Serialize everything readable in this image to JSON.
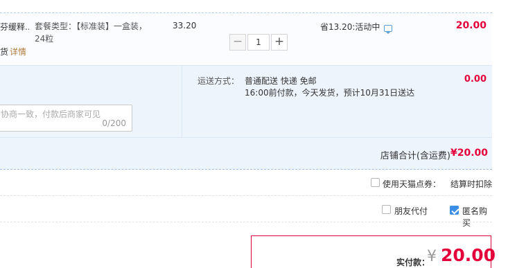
{
  "item": {
    "title": "芬缓释...",
    "sub_prefix": "货",
    "detail_link": "详情",
    "sku": "套餐类型：【标准装】一盒装，24粒",
    "price": "33.20",
    "quantity": "1",
    "minus": "−",
    "plus": "+",
    "promo": "省13.20:活动中",
    "subtotal": "20.00"
  },
  "shipping": {
    "label": "运送方式：",
    "options": "普通配送 快递 免邮",
    "eta": "16:00前付款，今天发货，预计10月31日送达",
    "fee": "0.00"
  },
  "message": {
    "placeholder": "协商一致，付款后商家可见",
    "count": "0/200"
  },
  "store_total": {
    "label": "店铺合计(含运费)",
    "value": "¥20.00"
  },
  "coupon": {
    "label": "使用天猫点券：",
    "note": "结算时扣除",
    "checked": false
  },
  "friend_pay": {
    "label": "朋友代付",
    "checked": false
  },
  "anonymous": {
    "label": "匿名购买",
    "checked": true
  },
  "payment": {
    "label": "实付款：",
    "currency": "¥",
    "amount": "20.00"
  },
  "colors": {
    "accent_red": "#e4003a",
    "checkbox_blue": "#3a8ee6",
    "block_bg": "#eef4fc"
  }
}
